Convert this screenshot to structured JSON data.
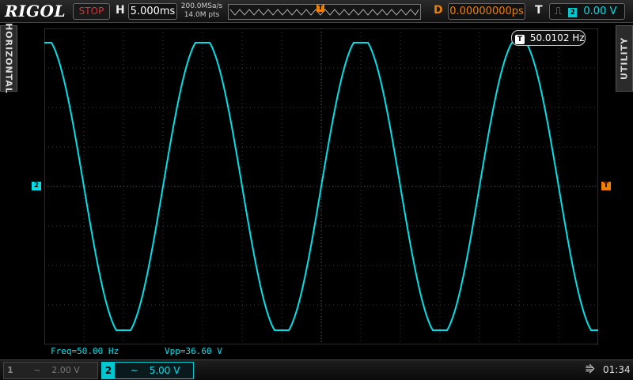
{
  "brand": "RIGOL",
  "run_state": "STOP",
  "horizontal": {
    "label": "H",
    "timebase": "5.000ms"
  },
  "acquisition": {
    "sample_rate": "200.0MSa/s",
    "memory_depth": "14.0M pts"
  },
  "delay": {
    "label": "D",
    "value": "0.00000000ps"
  },
  "trigger": {
    "label": "T",
    "slope_icon": "rising-edge-icon",
    "source": "2",
    "level": "0.00 V"
  },
  "side_tabs": {
    "left": "HORIZONTAL",
    "right": "UTILITY"
  },
  "freq_counter": {
    "badge": "T",
    "value": "50.0102 Hz"
  },
  "channel_marker": "2",
  "trigger_marker": "T",
  "measurements": {
    "freq": "Freq=50.00 Hz",
    "vpp": "Vpp=36.60 V"
  },
  "channels": [
    {
      "num": "1",
      "coupling": "~",
      "scale": "2.00 V",
      "active": false
    },
    {
      "num": "2",
      "coupling": "~",
      "scale": "5.00 V",
      "active": true
    }
  ],
  "clock": "01:34",
  "colors": {
    "ch2": "#00e0e8",
    "trigger": "#f08000",
    "stop": "#e03030"
  },
  "chart_data": {
    "type": "line",
    "series": [
      {
        "frequency_hz": 50.0,
        "vpp_v": 36.6,
        "shape": "clipped-sine",
        "color": "#00e0e8"
      }
    ],
    "xlabel": "",
    "ylabel": "",
    "grid": true
  }
}
